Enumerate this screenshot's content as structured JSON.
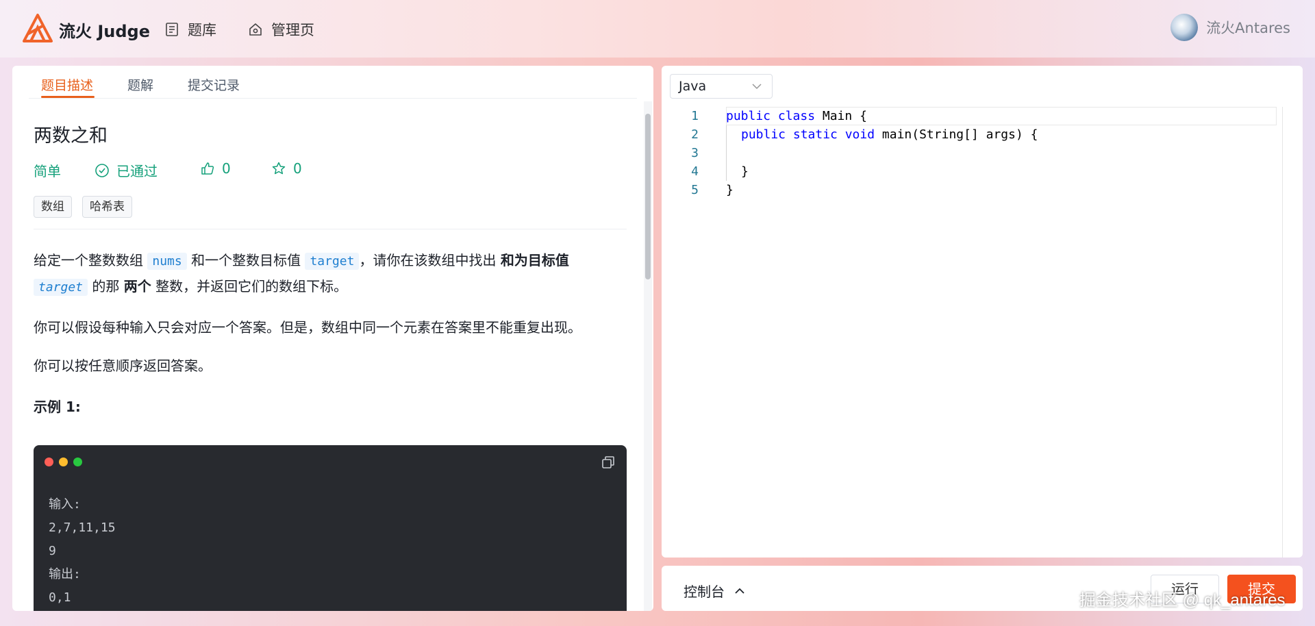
{
  "header": {
    "brand": "流火 Judge",
    "nav": [
      {
        "label": "题库",
        "icon": "list-icon"
      },
      {
        "label": "管理页",
        "icon": "home-gear-icon"
      }
    ],
    "user": {
      "name": "流火Antares",
      "avatar_icon": "avatar"
    }
  },
  "left": {
    "tabs": [
      "题目描述",
      "题解",
      "提交记录"
    ],
    "active_tab": "题目描述",
    "problem": {
      "title": "两数之和",
      "difficulty": "简单",
      "status": "已通过",
      "likes": "0",
      "stars": "0",
      "tags": [
        "数组",
        "哈希表"
      ]
    },
    "description": {
      "p1_a": "给定一个整数数组 ",
      "p1_code1": "nums",
      "p1_b": " 和一个整数目标值 ",
      "p1_code2": "target",
      "p1_c": "，请你在该数组中找出 ",
      "p1_bold1": "和为目标值",
      "p1_code3": "target",
      "p1_d": " 的那 ",
      "p1_bold2": "两个",
      "p1_e": " 整数，并返回它们的数组下标。",
      "p2": "你可以假设每种输入只会对应一个答案。但是，数组中同一个元素在答案里不能重复出现。",
      "p3": "你可以按任意顺序返回答案。",
      "example_title": "示例 1:"
    },
    "example_code": [
      "输入:",
      "2,7,11,15",
      "9",
      "输出:",
      "0,1"
    ]
  },
  "editor": {
    "language": "Java",
    "line_numbers": [
      "1",
      "2",
      "3",
      "4",
      "5"
    ],
    "lines": {
      "l1_kw": "public class",
      "l1_rest": " Main {",
      "l2_kw": "public static void",
      "l2_rest": " main(String[] args) {",
      "l4": "}",
      "l5": "}"
    }
  },
  "console": {
    "label": "控制台",
    "run": "运行",
    "submit": "提交"
  },
  "watermark": "掘金技术社区 @ qk_antares",
  "colors": {
    "accent": "#e8601c",
    "success": "#14a07a",
    "submit": "#f4511e"
  }
}
